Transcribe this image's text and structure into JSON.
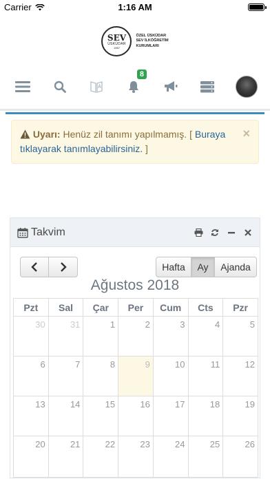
{
  "status": {
    "carrier": "Carrier",
    "time": "1:16 AM"
  },
  "logo": {
    "mark": "SEV",
    "mark_sub": "ÜSKÜDAR",
    "mark_year": "1967",
    "line1": "ÖZEL ÜSKÜDAR",
    "line2": "SEV İLKÖĞRETİM",
    "line3": "KURUMLARI"
  },
  "nav": {
    "icons": [
      "menu-icon",
      "search-icon",
      "book-icon",
      "bell-icon",
      "megaphone-icon",
      "server-icon",
      "avatar"
    ],
    "notification_count": "8"
  },
  "alert": {
    "label": "Uyarı:",
    "message": " Henüz zil tanımı yapılmamış. [ ",
    "link": "Buraya tıklayarak tanımlayabilirsiniz.",
    "end": " ]",
    "close": "×"
  },
  "calendar": {
    "title": "Takvim",
    "month": "Ağustos 2018",
    "views": [
      "Hafta",
      "Ay",
      "Ajanda"
    ],
    "active_view": "Ay",
    "weekdays": [
      "Pzt",
      "Sal",
      "Çar",
      "Per",
      "Cum",
      "Cts",
      "Pzr"
    ],
    "weeks": [
      [
        "30",
        "31",
        "1",
        "2",
        "3",
        "4",
        "5"
      ],
      [
        "6",
        "7",
        "8",
        "9",
        "10",
        "11",
        "12"
      ],
      [
        "13",
        "14",
        "15",
        "16",
        "17",
        "18",
        "19"
      ],
      [
        "20",
        "21",
        "22",
        "23",
        "24",
        "25",
        "26"
      ]
    ]
  },
  "colors": {
    "accent": "#3c8dbc",
    "badge": "#2ea44f",
    "alert_bg": "#fcf8e3",
    "today_bg": "#fcf8e3"
  }
}
